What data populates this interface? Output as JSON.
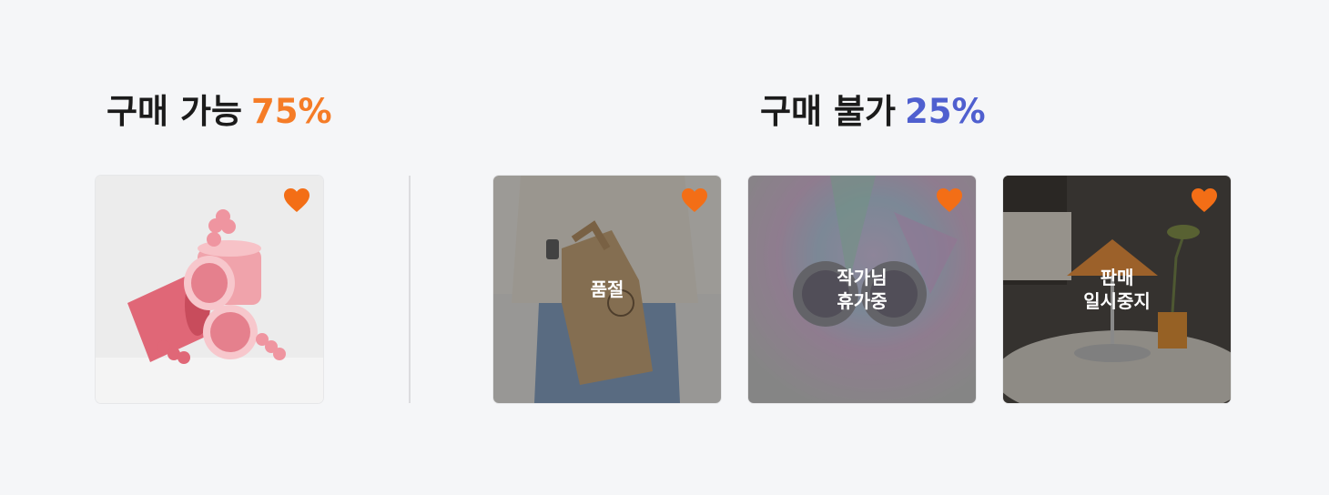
{
  "available": {
    "label": "구매 가능",
    "percent": "75%",
    "percent_color": "#f57c27"
  },
  "unavailable": {
    "label": "구매 불가",
    "percent": "25%",
    "percent_color": "#4f5fcf"
  },
  "accent_color": "#f36e16",
  "cards": [
    {
      "image": "pink-mugs-photo",
      "status": "",
      "icon": "heart-icon"
    },
    {
      "image": "kraft-bag-photo",
      "status": "품절",
      "icon": "heart-icon"
    },
    {
      "image": "glass-earrings-photo",
      "status_line1": "작가님",
      "status_line2": "휴가중",
      "icon": "heart-icon"
    },
    {
      "image": "origami-lamp-photo",
      "status_line1": "판매",
      "status_line2": "일시중지",
      "icon": "heart-icon"
    }
  ]
}
